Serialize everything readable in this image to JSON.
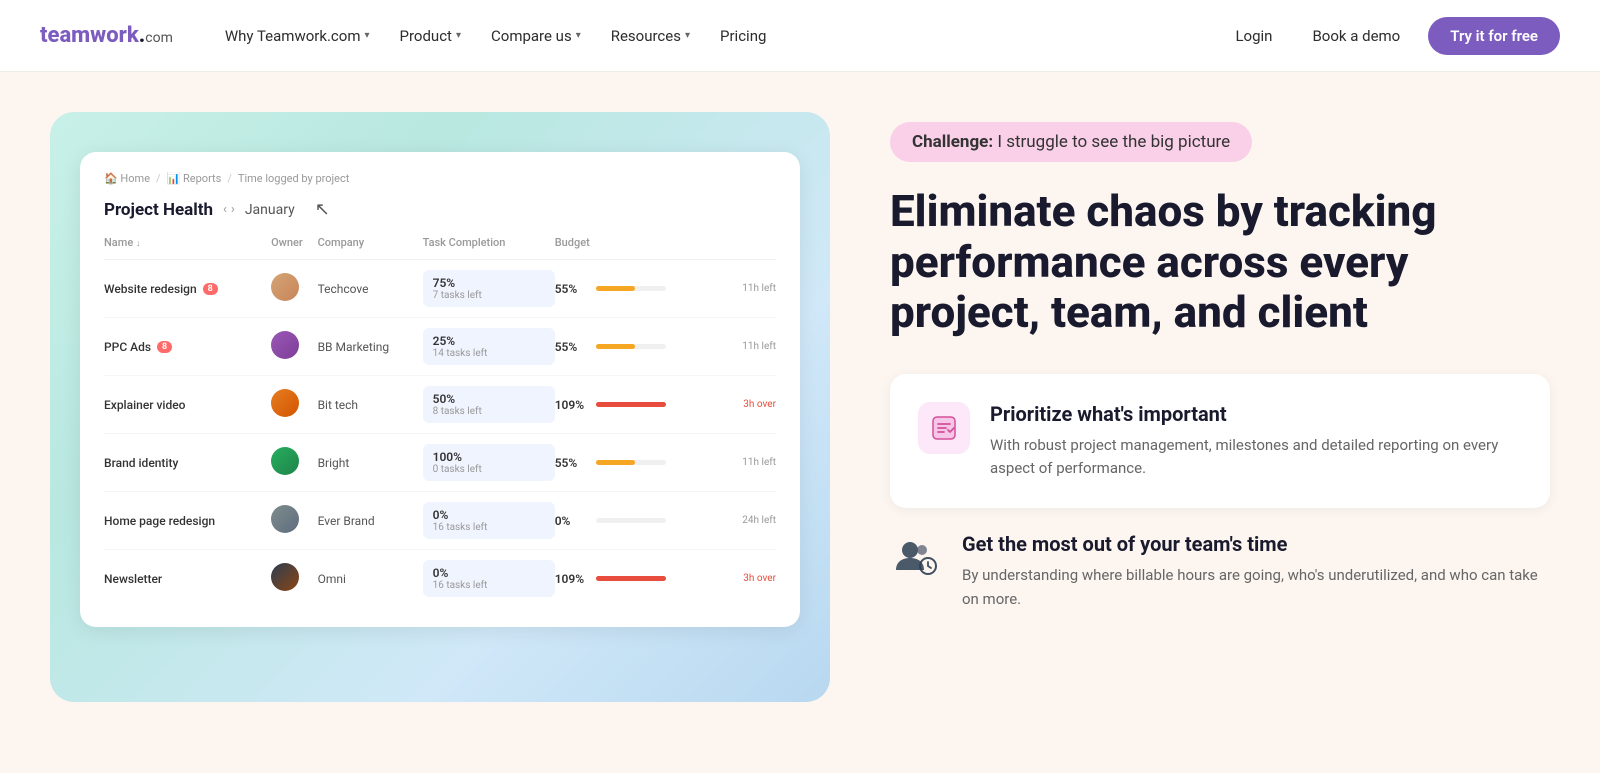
{
  "nav": {
    "logo": "teamwork",
    "logo_suffix": ".com",
    "items": [
      {
        "label": "Why Teamwork.com",
        "has_dropdown": true
      },
      {
        "label": "Product",
        "has_dropdown": true
      },
      {
        "label": "Compare us",
        "has_dropdown": true
      },
      {
        "label": "Resources",
        "has_dropdown": true
      },
      {
        "label": "Pricing",
        "has_dropdown": false
      }
    ],
    "login_label": "Login",
    "demo_label": "Book a demo",
    "cta_label": "Try it for free"
  },
  "dashboard": {
    "breadcrumb": [
      "Home",
      "Reports",
      "Time logged by project"
    ],
    "title": "Project Health",
    "month": "January",
    "columns": {
      "name": "Name",
      "owner": "Owner",
      "company": "Company",
      "task_completion": "Task Completion",
      "budget": "Budget"
    },
    "rows": [
      {
        "name": "Website redesign",
        "badge": "8",
        "avatar_class": "avatar-1",
        "company": "Techcove",
        "completion_pct": "75%",
        "completion_tasks": "7 tasks left",
        "completion_fill": 75,
        "budget_pct": "55%",
        "budget_fill": 55,
        "budget_fill_color": "yellow",
        "budget_time": "11h left",
        "budget_over": false
      },
      {
        "name": "PPC Ads",
        "badge": "8",
        "avatar_class": "avatar-2",
        "company": "BB Marketing",
        "completion_pct": "25%",
        "completion_tasks": "14 tasks left",
        "completion_fill": 25,
        "budget_pct": "55%",
        "budget_fill": 55,
        "budget_fill_color": "yellow",
        "budget_time": "11h left",
        "budget_over": false
      },
      {
        "name": "Explainer video",
        "badge": null,
        "avatar_class": "avatar-3",
        "company": "Bit tech",
        "completion_pct": "50%",
        "completion_tasks": "8 tasks left",
        "completion_fill": 50,
        "budget_pct": "109%",
        "budget_fill": 100,
        "budget_fill_color": "red",
        "budget_time": "3h over",
        "budget_over": true
      },
      {
        "name": "Brand identity",
        "badge": null,
        "avatar_class": "avatar-4",
        "company": "Bright",
        "completion_pct": "100%",
        "completion_tasks": "0 tasks left",
        "completion_fill": 100,
        "budget_pct": "55%",
        "budget_fill": 55,
        "budget_fill_color": "yellow",
        "budget_time": "11h left",
        "budget_over": false
      },
      {
        "name": "Home page redesign",
        "badge": null,
        "avatar_class": "avatar-5",
        "company": "Ever Brand",
        "completion_pct": "0%",
        "completion_tasks": "16 tasks left",
        "completion_fill": 0,
        "budget_pct": "0%",
        "budget_fill": 0,
        "budget_fill_color": "yellow",
        "budget_time": "24h left",
        "budget_over": false
      },
      {
        "name": "Newsletter",
        "badge": null,
        "avatar_class": "avatar-6",
        "company": "Omni",
        "completion_pct": "0%",
        "completion_tasks": "16 tasks left",
        "completion_fill": 0,
        "budget_pct": "109%",
        "budget_fill": 100,
        "budget_fill_color": "red",
        "budget_time": "3h over",
        "budget_over": true
      }
    ]
  },
  "right": {
    "challenge_label": "Challenge:",
    "challenge_text": " I struggle to see the big picture",
    "hero_title": "Eliminate chaos by tracking performance across every project, team, and client",
    "feature1": {
      "title": "Prioritize what's important",
      "desc": "With robust project management, milestones and detailed reporting on every aspect of performance."
    },
    "feature2": {
      "title": "Get the most out of your team's time",
      "desc": "By understanding where billable hours are going, who's underutilized, and who can take on more."
    }
  }
}
